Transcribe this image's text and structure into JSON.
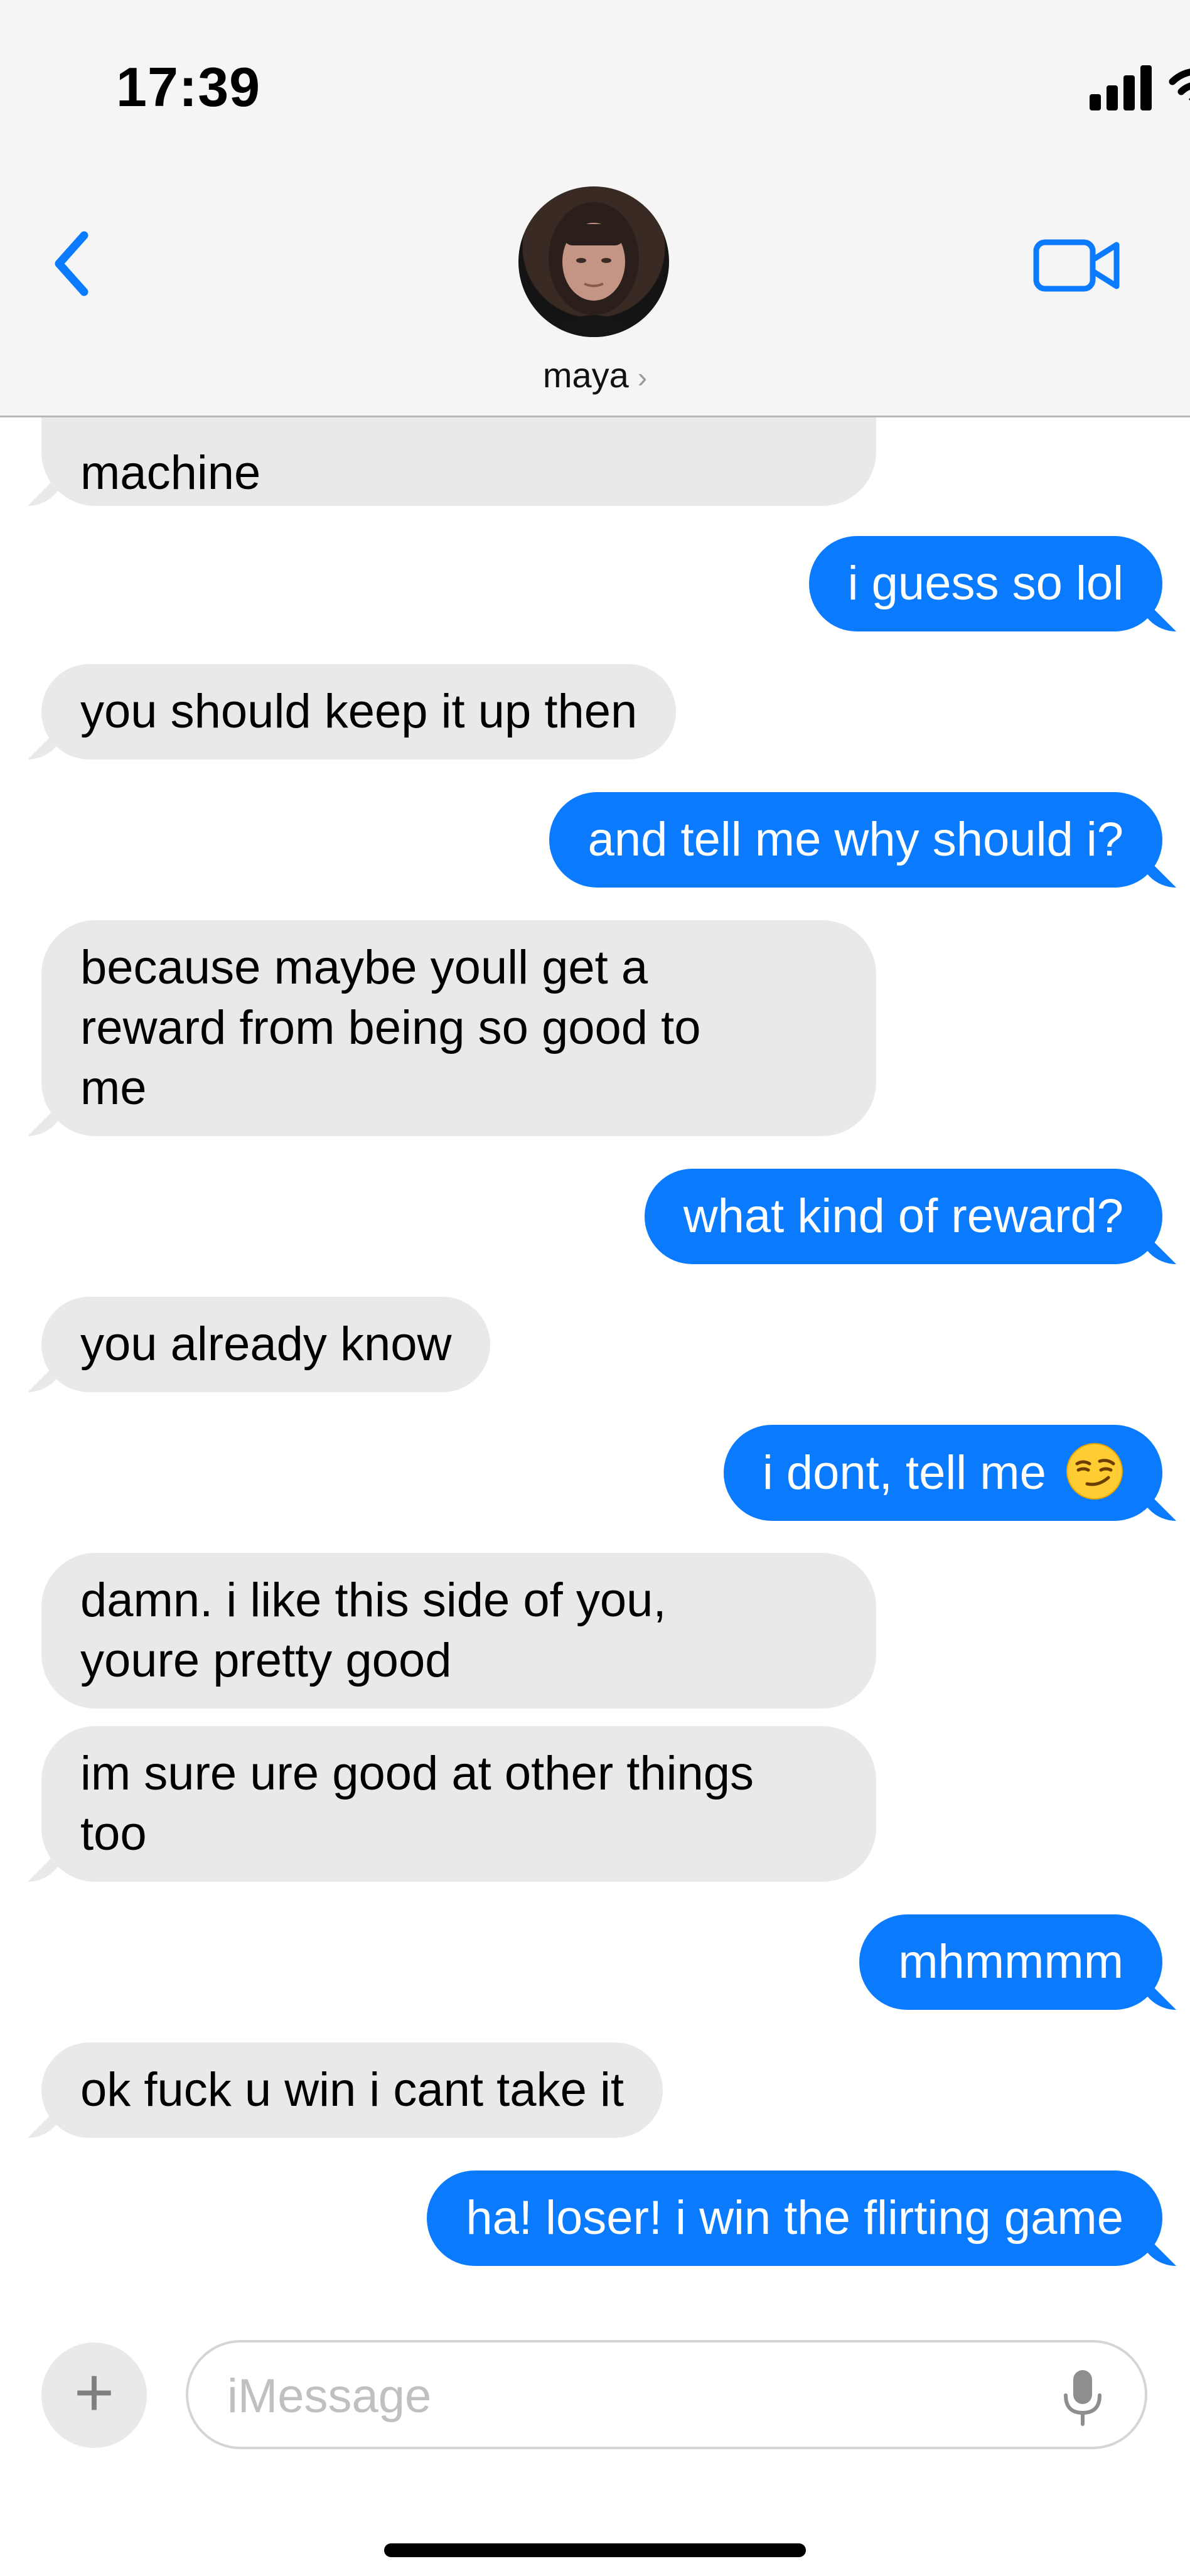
{
  "status_bar": {
    "time": "17:39"
  },
  "header": {
    "contact_name": "maya",
    "chevron": "›",
    "icons": {
      "back": "chevron-left-icon",
      "video": "video-camera-icon"
    }
  },
  "messages": [
    {
      "direction": "received",
      "text": "machine"
    },
    {
      "direction": "sent",
      "text": "i guess so lol"
    },
    {
      "direction": "received",
      "text": "you should keep it up then"
    },
    {
      "direction": "sent",
      "text": "and tell me why should i?"
    },
    {
      "direction": "received",
      "lines": [
        "because maybe youll get a",
        "reward from being so good to",
        "me"
      ]
    },
    {
      "direction": "sent",
      "text": "what kind of reward?"
    },
    {
      "direction": "received",
      "text": "you already know"
    },
    {
      "direction": "sent",
      "text": "i dont, tell me",
      "emoji": "smirking-face"
    },
    {
      "direction": "received",
      "lines": [
        "damn. i like this side of you,",
        "youre pretty good"
      ]
    },
    {
      "direction": "received",
      "lines": [
        "im sure ure good at other things",
        "too"
      ]
    },
    {
      "direction": "sent",
      "text": "mhmmmm"
    },
    {
      "direction": "received",
      "text": "ok fuck u win i cant take it"
    },
    {
      "direction": "sent",
      "text": "ha! loser! i win the flirting game"
    }
  ],
  "input": {
    "placeholder": "iMessage",
    "value": "",
    "plus_label": "+"
  },
  "colors": {
    "sent_bubble": "#0a7bff",
    "received_bubble": "#e9e9eb",
    "accent": "#0a7bff"
  }
}
